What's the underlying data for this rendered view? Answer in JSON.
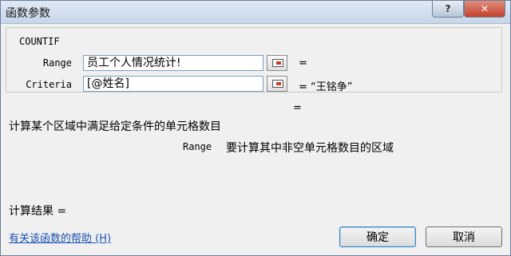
{
  "window": {
    "title": "函数参数",
    "help_glyph": "?",
    "close_glyph": "✕"
  },
  "function": {
    "name": "COUNTIF"
  },
  "args": [
    {
      "label": "Range",
      "value": "员工个人情况统计!",
      "result": "="
    },
    {
      "label": "Criteria",
      "value": "[@姓名]",
      "result": "= “王铭争”"
    }
  ],
  "function_result": "=",
  "description": "计算某个区域中满足给定条件的单元格数目",
  "arg_description": {
    "name": "Range",
    "text": "要计算其中非空单元格数目的区域"
  },
  "calc_result": {
    "label": "计算结果 ="
  },
  "help_link": "有关该函数的帮助 (H)",
  "buttons": {
    "ok": "确定",
    "cancel": "取消"
  }
}
